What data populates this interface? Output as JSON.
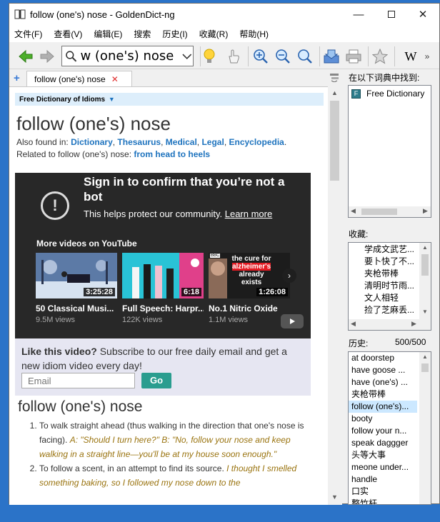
{
  "window": {
    "title": "follow (one's) nose - GoldenDict-ng"
  },
  "menu": [
    "文件(F)",
    "查看(V)",
    "编辑(E)",
    "搜索",
    "历史(I)",
    "收藏(R)",
    "帮助(H)"
  ],
  "toolbar": {
    "search_value": "w (one's) nose",
    "wiki_label": "W"
  },
  "tab": {
    "label": "follow (one's) nose"
  },
  "article": {
    "dict_name": "Free Dictionary of Idioms",
    "headword": "follow (one's) nose",
    "also_found_prefix": "Also found in: ",
    "also_found": [
      "Dictionary",
      "Thesaurus",
      "Medical",
      "Legal",
      "Encyclopedia"
    ],
    "related_prefix": "Related to follow (one's) nose: ",
    "related_link": "from head to heels"
  },
  "youtube": {
    "title": "Sign in to confirm that you’re not a bot",
    "body": "This helps protect our community. ",
    "learn_more": "Learn more",
    "more_videos": "More videos on YouTube",
    "videos": [
      {
        "title": "50 Classical Musi...",
        "views": "9.5M views",
        "duration": "3:25:28"
      },
      {
        "title": "Full Speech: Harpr...",
        "views": "122K views",
        "duration": "6:18"
      },
      {
        "title": "No.1 Nitric Oxide ...",
        "views": "1.1M views",
        "duration": "1:26:08"
      }
    ],
    "thumb3_text": "the cure for alzheimer's already exists",
    "thumb3_highlight": "alzheimer's",
    "thumb3_badge": "BBC"
  },
  "promo": {
    "bold": "Like this video?",
    "text": " Subscribe to our free daily email and get a new idiom video every day!",
    "email_placeholder": "Email",
    "go": "Go"
  },
  "definition": {
    "headword": "follow (one's) nose",
    "senses": [
      {
        "text": "To walk straight ahead (thus walking in the direction that one's nose is facing). ",
        "example": "A: \"Should I turn here?\" B: \"No, follow your nose and keep walking in a straight line—you'll be at my house soon enough.\""
      },
      {
        "text": "To follow a scent, in an attempt to find its source. ",
        "example": "I thought I smelled something baking, so I followed my nose down to the"
      }
    ]
  },
  "right": {
    "found_label": "在以下词典中找到:",
    "found_items": [
      "Free Dictionary"
    ],
    "favorites_label": "收藏:",
    "favorites": [
      "学成文武艺...",
      "要卜快了不...",
      "夹枪带棒",
      "清明时节雨...",
      "文人相轻",
      "捡了芝麻丢..."
    ],
    "history_label": "历史:",
    "history_count": "500/500",
    "history": [
      "at doorstep",
      "have goose ...",
      "have (one's) ...",
      "夹枪带棒",
      "follow (one's)...",
      "booty",
      "follow your n...",
      "speak daggger",
      "头等大事",
      "meone under...",
      "handle",
      "口实",
      "整竹杆"
    ]
  },
  "colors": {
    "accent": "#1e73be",
    "go": "#2a9d8f",
    "example": "#9a7410",
    "selection": "#cce8ff"
  }
}
